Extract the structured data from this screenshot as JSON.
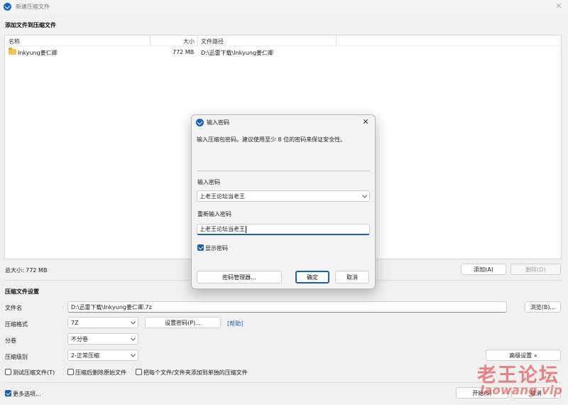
{
  "window": {
    "title": "新建压缩文件",
    "close_glyph": "✕"
  },
  "add_section": {
    "title": "添加文件到压缩文件"
  },
  "file_list": {
    "headers": {
      "name": "名称",
      "size": "大小",
      "path": "文件路径"
    },
    "rows": [
      {
        "name": "Inkyung姜仁卿",
        "size": "772 MB",
        "path": "D:\\迅雷下载\\Inkyung姜仁卿",
        "icon": "folder-icon"
      }
    ]
  },
  "total_size": "总大小: 772 MB",
  "buttons": {
    "add": "添加(A)",
    "delete": "删除(D)",
    "browse": "浏览(B)...",
    "set_password": "设置密码(P)...",
    "advanced": "高级设置 »",
    "start": "开始(S)",
    "cancel": "取消"
  },
  "settings": {
    "title": "压缩文件设置",
    "filename_label": "文件名",
    "filename_value": "D:\\迅雷下载\\Inkyung姜仁卿.7z",
    "format_label": "压缩格式",
    "format_value": "7Z",
    "help_link": "[帮助]",
    "split_label": "分卷",
    "split_value": "不分卷",
    "level_label": "压缩级别",
    "level_value": "2-正常压缩"
  },
  "options": {
    "test_archive": "测试压缩文件(T)",
    "delete_after": "压缩后删除原始文件",
    "separate_archives": "把每个文件/文件夹添加到单独的压缩文件",
    "more_options": "更多选项...",
    "more_options_checked": true
  },
  "dialog": {
    "title": "输入密码",
    "close_glyph": "✕",
    "message": "输入压缩包密码。建议使用至少 8 位的密码来保证安全性。",
    "password_label": "输入密码",
    "password_value": "上老王论坛当老王",
    "confirm_label": "重新输入密码",
    "confirm_value": "上老王论坛当老王",
    "show_password": "显示密码",
    "show_password_checked": true,
    "manager_button": "密码管理器...",
    "ok_button": "确定",
    "cancel_button": "取消"
  },
  "watermark": {
    "cn": "老王论坛",
    "en": "laowang.vip"
  },
  "colors": {
    "accent": "#1a5fb4",
    "watermark": "#e12828"
  }
}
